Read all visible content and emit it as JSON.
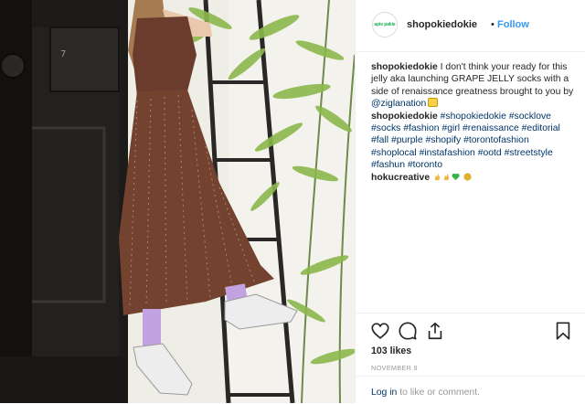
{
  "post": {
    "username": "shopokiedokie",
    "separator": "•",
    "follow_label": "Follow",
    "avatar_text": "apie pakie",
    "caption": {
      "username": "shopokiedokie",
      "text1": "I don't think your ready for this jelly aka launching GRAPE JELLY socks with a side of renaissance greatness brought to you by",
      "mention": "@ziglanation",
      "username2": "shopokiedokie",
      "hashtags": [
        "#shopokiedokie",
        "#socklove",
        "#socks",
        "#fashion",
        "#girl",
        "#renaissance",
        "#editorial",
        "#fall",
        "#purple",
        "#shopify",
        "#torontofashion",
        "#shoplocal",
        "#instafashion",
        "#ootd",
        "#streetstyle",
        "#fashun",
        "#toronto"
      ],
      "commenter": "hokucreative"
    },
    "likes": "103 likes",
    "date": "NOVEMBER 9",
    "login_link": "Log in",
    "login_rest": " to like or comment."
  },
  "icons": [
    "heart-icon",
    "comment-icon",
    "share-icon",
    "bookmark-icon"
  ],
  "colors": {
    "link": "#3897f0",
    "hashtag": "#003569",
    "muted": "#999999",
    "text": "#262626"
  }
}
